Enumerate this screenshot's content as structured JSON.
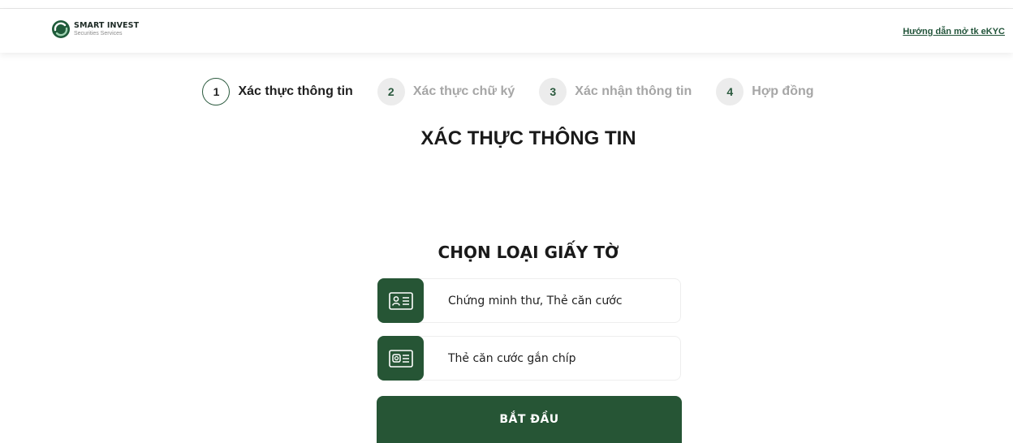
{
  "header": {
    "logo_name": "SMART INVEST",
    "logo_subtitle": "Securities Services",
    "guide_link": "Hướng dẫn mở tk eKYC"
  },
  "stepper": {
    "steps": [
      {
        "number": "1",
        "label": "Xác thực thông tin",
        "state": "active"
      },
      {
        "number": "2",
        "label": "Xác thực chữ ký",
        "state": "pending"
      },
      {
        "number": "3",
        "label": "Xác nhận thông tin",
        "state": "pending"
      },
      {
        "number": "4",
        "label": "Hợp đồng",
        "state": "pending"
      }
    ]
  },
  "main": {
    "title": "XÁC THỰC THÔNG TIN",
    "section_title": "CHỌN LOẠI GIẤY TỜ",
    "options": [
      {
        "label": "Chứng minh thư, Thẻ căn cước",
        "icon": "id-card-icon"
      },
      {
        "label": "Thẻ căn cước gắn chíp",
        "icon": "chip-id-card-icon"
      }
    ],
    "start_button": "BẮT ĐẦU"
  },
  "colors": {
    "brand_green": "#265535",
    "inactive_text": "#a6a6a6",
    "step_circle_bg": "#ececec"
  }
}
